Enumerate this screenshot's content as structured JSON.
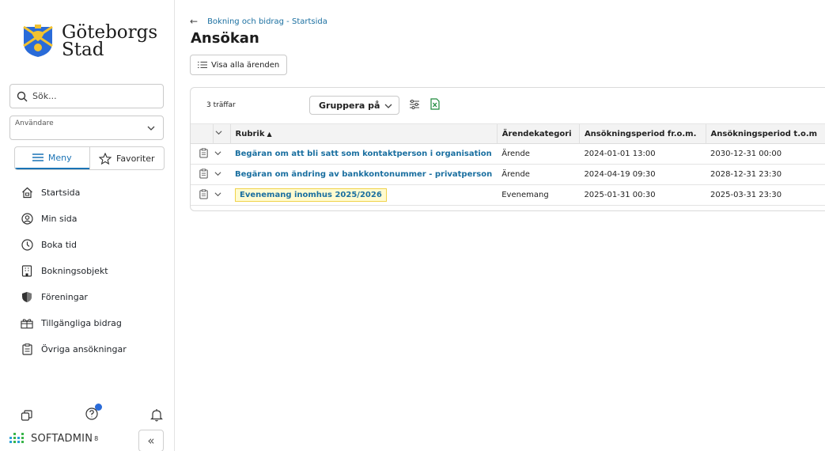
{
  "logo": {
    "line1": "Göteborgs",
    "line2": "Stad"
  },
  "sidebar": {
    "search_placeholder": "Sök...",
    "user_label": "Användare",
    "menu_tab": "Meny",
    "favorites_tab": "Favoriter",
    "items": [
      {
        "label": "Startsida",
        "icon": "home-icon"
      },
      {
        "label": "Min sida",
        "icon": "user-icon"
      },
      {
        "label": "Boka tid",
        "icon": "clock-icon"
      },
      {
        "label": "Bokningsobjekt",
        "icon": "building-icon"
      },
      {
        "label": "Föreningar",
        "icon": "shield-icon"
      },
      {
        "label": "Tillgängliga bidrag",
        "icon": "gift-icon"
      },
      {
        "label": "Övriga ansökningar",
        "icon": "clipboard-icon"
      }
    ],
    "brand": "SOFTADMIN",
    "brand_version": "8"
  },
  "main": {
    "breadcrumb": "Bokning och bidrag - Startsida",
    "title": "Ansökan",
    "show_all": "Visa alla ärenden",
    "hits": "3 träffar",
    "group_by": "Gruppera på",
    "columns": [
      "Rubrik",
      "Ärendekategori",
      "Ansökningsperiod fr.o.m.",
      "Ansökningsperiod t.o.m"
    ],
    "rows": [
      {
        "title": "Begäran om att bli satt som kontaktperson i organisation",
        "category": "Ärende",
        "from": "2024-01-01 13:00",
        "to": "2030-12-31 00:00"
      },
      {
        "title": "Begäran om ändring av bankkontonummer - privatperson",
        "category": "Ärende",
        "from": "2024-04-19 09:30",
        "to": "2028-12-31 23:30"
      },
      {
        "title": "Evenemang inomhus 2025/2026",
        "category": "Evenemang",
        "from": "2025-01-31 00:30",
        "to": "2025-03-31 23:30"
      }
    ]
  },
  "colors": {
    "link": "#1a6fa0",
    "accent": "#1a73b5",
    "highlight": "#fffbd0"
  }
}
